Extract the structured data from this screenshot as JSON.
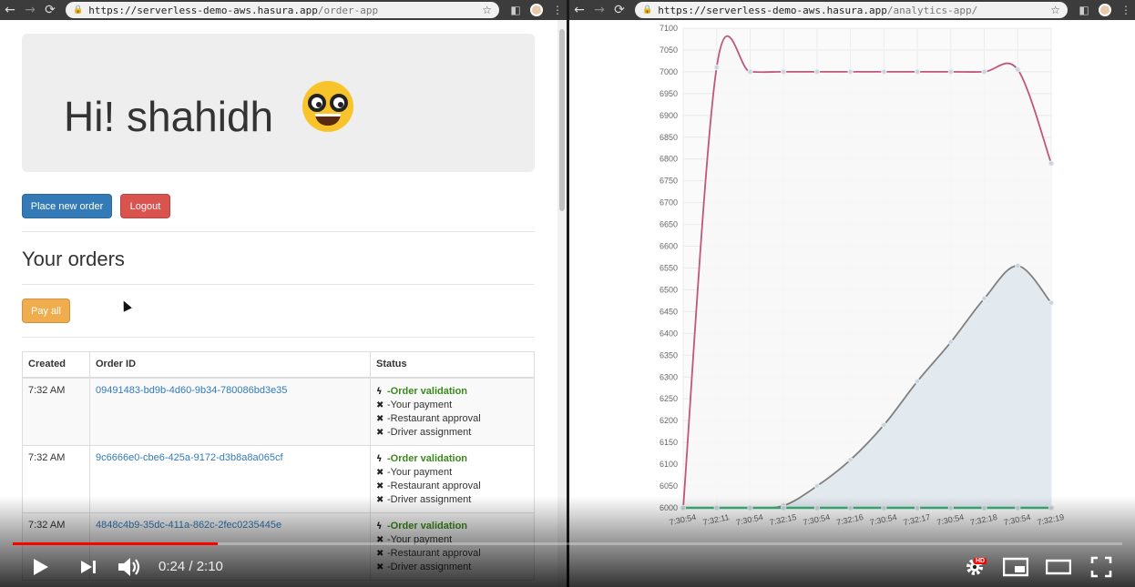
{
  "browser_left": {
    "url_host": "https://serverless-demo-aws.hasura.app",
    "url_path": "/order-app"
  },
  "browser_right": {
    "url_host": "https://serverless-demo-aws.hasura.app",
    "url_path": "/analytics-app/"
  },
  "order_app": {
    "greeting": "Hi! shahidh",
    "place_order_label": "Place new order",
    "logout_label": "Logout",
    "orders_title": "Your orders",
    "pay_all_label": "Pay all",
    "columns": [
      "Created",
      "Order ID",
      "Status"
    ],
    "status_steps": [
      "-Order validation",
      "-Your payment",
      "-Restaurant approval",
      "-Driver assignment"
    ],
    "orders": [
      {
        "created": "7:32 AM",
        "id": "09491483-bd9b-4d60-9b34-780086bd3e35"
      },
      {
        "created": "7:32 AM",
        "id": "9c6666e0-cbe6-425a-9172-d3b8a8a065cf"
      },
      {
        "created": "7:32 AM",
        "id": "4848c4b9-35dc-411a-862c-2fec0235445e"
      }
    ]
  },
  "chart_data": {
    "type": "line",
    "ylim": [
      6000,
      7100
    ],
    "ytick_labels": [
      "7100",
      "7050",
      "7000",
      "6950",
      "6900",
      "6850",
      "6800",
      "6750",
      "6700",
      "6650",
      "6600",
      "6550",
      "6500",
      "6450",
      "6400",
      "6350",
      "6300",
      "6250",
      "6200",
      "6150",
      "6100",
      "6050",
      "6000"
    ],
    "x": [
      "7:30:54",
      "7:32:11",
      "7:30:54",
      "7:32:15",
      "7:30:54",
      "7:32:16",
      "7:30:54",
      "7:32:17",
      "7:30:54",
      "7:32:18",
      "7:30:54",
      "7:32:19"
    ],
    "series": [
      {
        "values": [
          6000,
          7010,
          7000,
          7000,
          7000,
          7000,
          7000,
          7000,
          7000,
          7000,
          7005,
          6790
        ],
        "color": "#c0577a",
        "fill": "#f7f7f7"
      },
      {
        "values": [
          6000,
          6000,
          6000,
          6005,
          6050,
          6110,
          6190,
          6290,
          6380,
          6480,
          6555,
          6470
        ],
        "color": "#7f7f7f",
        "fill": "#dfe8ee"
      },
      {
        "values": [
          6000,
          6000,
          6000,
          6000,
          6000,
          6000,
          6000,
          6000,
          6000,
          6000,
          6000,
          6000
        ],
        "color": "#3bb37a",
        "fill": "none"
      }
    ],
    "grid": true
  },
  "player": {
    "time_text": "0:24 / 2:10",
    "progress_fraction": 0.185,
    "hd_label": "HD"
  }
}
